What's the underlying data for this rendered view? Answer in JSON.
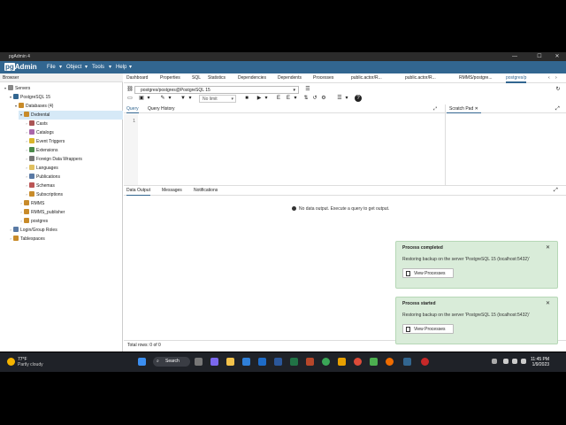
{
  "window": {
    "title": "pgAdmin 4"
  },
  "menubar": {
    "logo_pg": "pg",
    "logo_admin": "Admin",
    "items": [
      "File",
      "Object",
      "Tools",
      "Help"
    ]
  },
  "browser": {
    "title": "Browser",
    "tree": [
      "Servers",
      "PostgreSQL 15",
      "Databases (4)",
      "Dvdrental",
      "Casts",
      "Catalogs",
      "Event Triggers",
      "Extensions",
      "Foreign Data Wrappers",
      "Languages",
      "Publications",
      "Schemas",
      "Subscriptions",
      "RMMS",
      "RMMS_publisher",
      "postgres",
      "Login/Group Roles",
      "Tablespaces"
    ]
  },
  "tabs": [
    "Dashboard",
    "Properties",
    "SQL",
    "Statistics",
    "Dependencies",
    "Dependents",
    "Processes",
    "public.actor/R...",
    "public.actor/R...",
    "RMMS/postgre...",
    "postgres/p"
  ],
  "toolbar": {
    "connection": "postgres/postgres@PostgreSQL 15",
    "limit": "No limit"
  },
  "query_tabs": [
    "Query",
    "Query History"
  ],
  "scratch_pad": "Scratch Pad",
  "editor": {
    "line_number": "1"
  },
  "output_tabs": [
    "Data Output",
    "Messages",
    "Notifications"
  ],
  "output": {
    "empty_msg": "No data output. Execute a query to get output."
  },
  "status": {
    "rows": "Total rows: 0 of 0"
  },
  "notifications": [
    {
      "title": "Process completed",
      "message": "Restoring backup on the server 'PostgreSQL 15 (localhost:5432)'",
      "button": "View Processes"
    },
    {
      "title": "Process started",
      "message": "Restoring backup on the server 'PostgreSQL 15 (localhost:5432)'",
      "button": "View Processes"
    }
  ],
  "taskbar": {
    "temp": "77°F",
    "weather": "Partly cloudy",
    "search": "Search",
    "time": "11:45 PM",
    "date": "1/9/2023"
  },
  "colors": {
    "brand": "#326690",
    "notif_bg": "#d9ecd9",
    "selected": "#d6e9f7"
  }
}
